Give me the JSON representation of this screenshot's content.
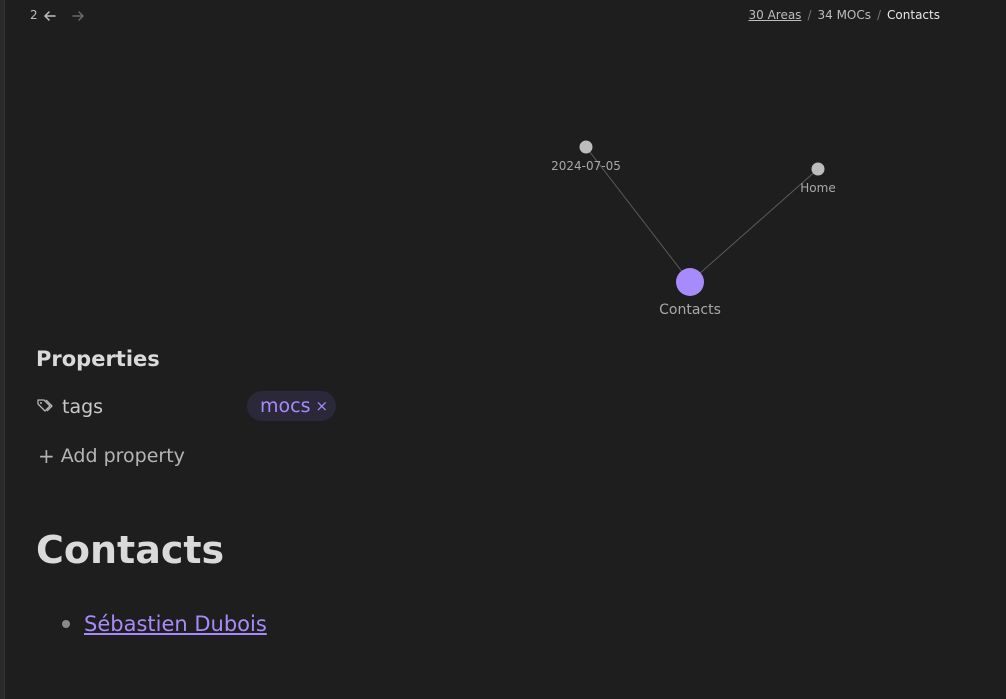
{
  "header": {
    "nav_count": "2",
    "breadcrumb": {
      "crumb_1": "30 Areas",
      "crumb_2": "34 MOCs",
      "current": "Contacts",
      "separator": "/"
    }
  },
  "graph": {
    "nodes": {
      "date": "2024-07-05",
      "home": "Home",
      "current": "Contacts"
    },
    "colors": {
      "current_node": "#a88bfa",
      "other_node": "#bdbdbd",
      "edge": "#5a5a5a"
    }
  },
  "properties": {
    "title": "Properties",
    "tags_key": "tags",
    "tag_value": "mocs",
    "tag_remove": "×",
    "add_label": "Add property",
    "add_plus": "+"
  },
  "document": {
    "title": "Contacts",
    "items": [
      {
        "label": "Sébastien Dubois"
      }
    ]
  },
  "colors": {
    "background": "#1e1e1e",
    "accent": "#a88bfa",
    "text": "#dadada"
  }
}
